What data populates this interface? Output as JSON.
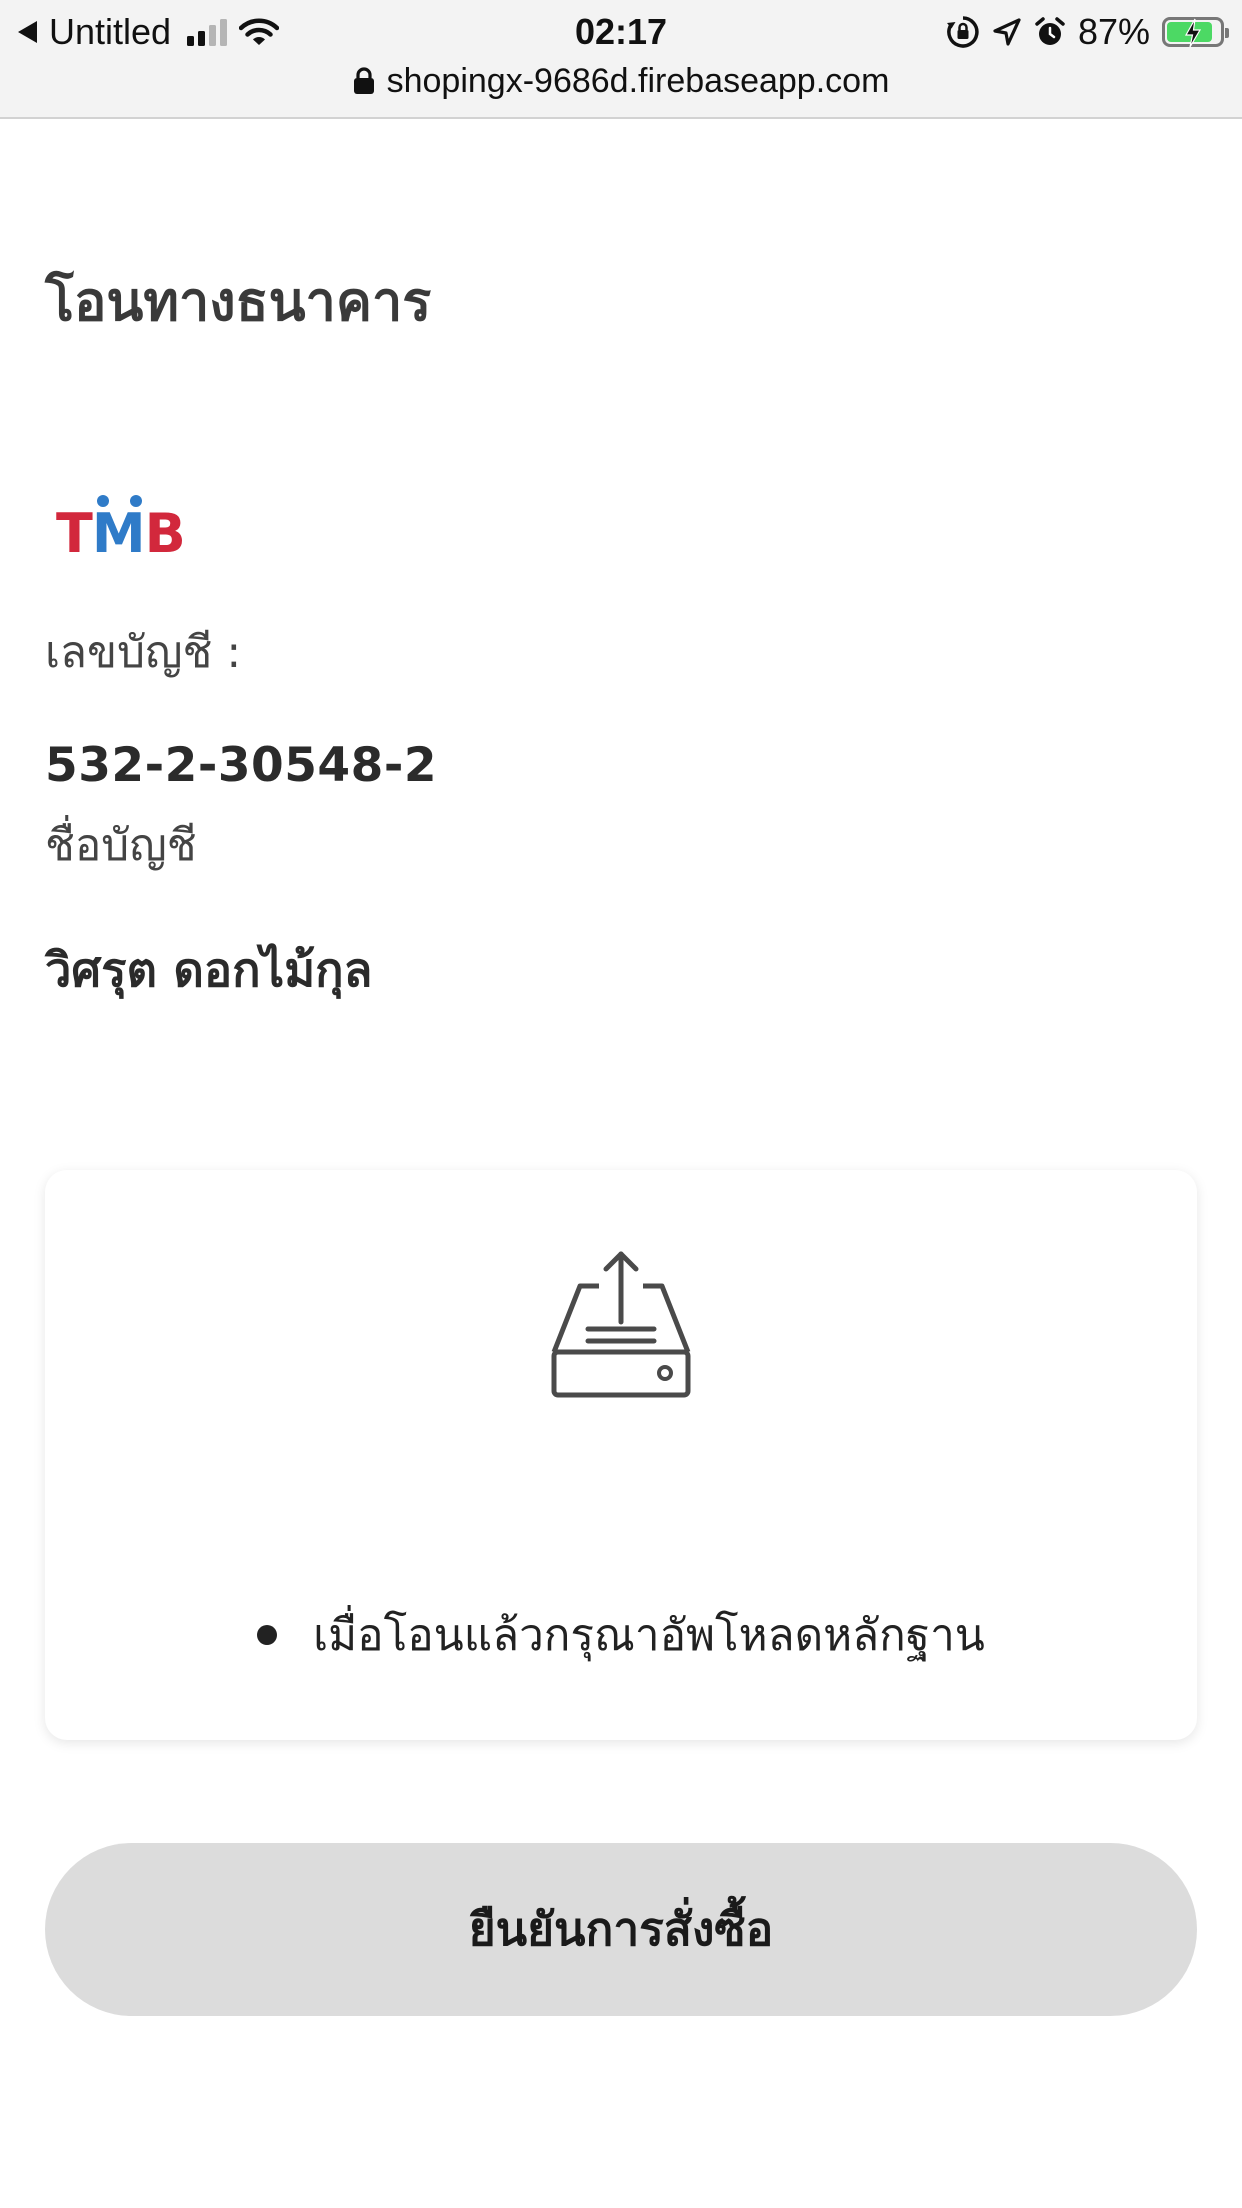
{
  "status_bar": {
    "back_app": "Untitled",
    "time": "02:17",
    "battery": "87%",
    "battery_level": 0.87
  },
  "browser": {
    "url": "shopingx-9686d.firebaseapp.com"
  },
  "payment": {
    "title": "โอนทางธนาคาร",
    "bank_logo_text": "TMB",
    "account_number_label": "เลขบัญชี :",
    "account_number": "532-2-30548-2",
    "account_name_label": "ชื่อบัญชี",
    "account_name": "วิศรุต ดอกไม้กุล"
  },
  "upload": {
    "icon": "upload-tray-icon",
    "hint": "เมื่อโอนแล้วกรุณาอัพโหลดหลักฐาน"
  },
  "actions": {
    "confirm_label": "ยืนยันการสั่งซื้อ"
  },
  "colors": {
    "logo_red": "#d2283c",
    "logo_blue": "#2f7bc8",
    "button_bg": "#dcdcdc",
    "battery_green": "#4cd964"
  }
}
